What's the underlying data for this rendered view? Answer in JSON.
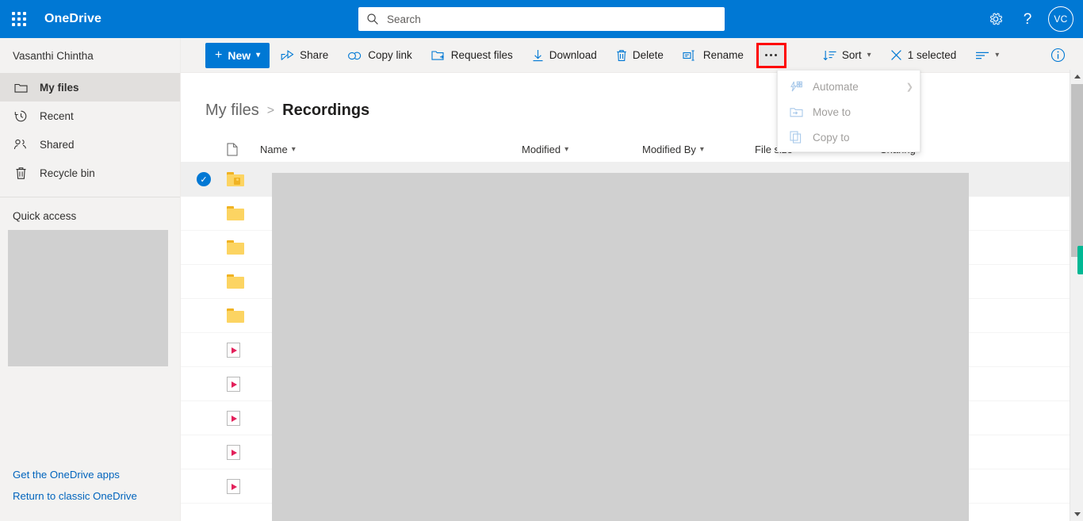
{
  "suite": {
    "waffle_label": "App launcher",
    "brand": "OneDrive",
    "search": {
      "placeholder": "Search",
      "value": ""
    },
    "settings_label": "Settings",
    "help_label": "?",
    "avatar_initials": "VC"
  },
  "sidebar": {
    "owner": "Vasanthi Chintha",
    "items": [
      {
        "label": "My files",
        "icon": "folder-icon",
        "selected": true
      },
      {
        "label": "Recent",
        "icon": "clock-icon",
        "selected": false
      },
      {
        "label": "Shared",
        "icon": "people-icon",
        "selected": false
      },
      {
        "label": "Recycle bin",
        "icon": "trash-icon",
        "selected": false
      }
    ],
    "quick_access_label": "Quick access",
    "links": [
      {
        "label": "Get the OneDrive apps"
      },
      {
        "label": "Return to classic OneDrive"
      }
    ]
  },
  "toolbar": {
    "new_label": "New",
    "commands": [
      {
        "label": "Share",
        "icon": "share-icon"
      },
      {
        "label": "Copy link",
        "icon": "link-icon"
      },
      {
        "label": "Request files",
        "icon": "request-files-icon"
      },
      {
        "label": "Download",
        "icon": "download-icon"
      },
      {
        "label": "Delete",
        "icon": "trash-icon"
      },
      {
        "label": "Rename",
        "icon": "rename-icon"
      }
    ],
    "more_label": "More options",
    "sort_label": "Sort",
    "selection_label": "1 selected",
    "view_label": "View options",
    "info_label": "Details"
  },
  "more_menu": {
    "items": [
      {
        "label": "Automate",
        "icon": "automate-icon",
        "has_submenu": true,
        "disabled": true
      },
      {
        "label": "Move to",
        "icon": "move-to-icon",
        "has_submenu": false,
        "disabled": true
      },
      {
        "label": "Copy to",
        "icon": "copy-to-icon",
        "has_submenu": false,
        "disabled": true
      }
    ]
  },
  "breadcrumb": {
    "parent": "My files",
    "separator": ">",
    "current": "Recordings"
  },
  "file_list": {
    "columns": [
      {
        "label": "Name",
        "sortable": true
      },
      {
        "label": "Modified",
        "sortable": true
      },
      {
        "label": "Modified By",
        "sortable": true
      },
      {
        "label": "File size",
        "sortable": true
      },
      {
        "label": "Sharing",
        "sortable": false
      }
    ],
    "rows": [
      {
        "icon": "shared-folder-icon",
        "selected": true
      },
      {
        "icon": "folder-icon",
        "selected": false
      },
      {
        "icon": "folder-icon",
        "selected": false
      },
      {
        "icon": "folder-icon",
        "selected": false
      },
      {
        "icon": "folder-icon",
        "selected": false
      },
      {
        "icon": "video-file-icon",
        "selected": false
      },
      {
        "icon": "video-file-icon",
        "selected": false
      },
      {
        "icon": "video-file-icon",
        "selected": false
      },
      {
        "icon": "video-file-icon",
        "selected": false
      },
      {
        "icon": "video-file-icon",
        "selected": false
      }
    ]
  },
  "colors": {
    "brand_blue": "#0078d4",
    "chrome_grey": "#f3f2f1",
    "highlight_red": "#ff0000",
    "folder_yellow": "#fcd462",
    "scroll_marker_green": "#00b894"
  }
}
